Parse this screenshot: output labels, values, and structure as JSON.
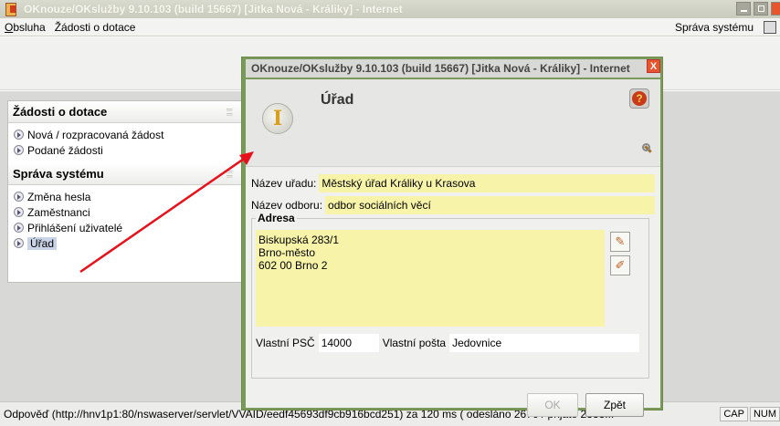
{
  "main_window": {
    "title": "OKnouze/OKslužby 9.10.103 (build 15667)  [Jitka Nová - Králiky] - Internet"
  },
  "menubar": {
    "items": [
      {
        "label": "Obsluha",
        "mnemonic": "O",
        "rest": "bsluha"
      },
      {
        "label": "Žádosti o dotace"
      }
    ],
    "right_label": "Správa systému"
  },
  "left_panel": {
    "sections": [
      {
        "title": "Žádosti o dotace",
        "items": [
          "Nová / rozpracovaná žádost",
          "Podané žádosti"
        ]
      },
      {
        "title": "Správa systému",
        "items": [
          "Změna hesla",
          "Zaměstnanci",
          "Přihlášení uživatelé",
          "Úřad"
        ]
      }
    ],
    "active_item": "Úřad"
  },
  "dialog": {
    "title": "OKnouze/OKslužby 9.10.103 (build 15667)  [Jitka Nová - Králiky] - Internet",
    "close_glyph": "X",
    "heading": "Úřad",
    "icon_glyph": "I",
    "help_glyph": "?",
    "fields": {
      "nazev_uradu_label": "Název uřadu:",
      "nazev_uradu_value": "Městský úřad Králiky u Krasova",
      "nazev_odboru_label": "Název odboru:",
      "nazev_odboru_value": "odbor sociálních věcí"
    },
    "address": {
      "legend": "Adresa",
      "lines": [
        "Biskupská 283/1",
        "Brno-město",
        "602 00 Brno 2"
      ],
      "psc_label": "Vlastní PSČ",
      "psc_value": "14000",
      "posta_label": "Vlastní pošta",
      "posta_value": "Jedovnice"
    },
    "buttons": {
      "ok": "OK",
      "back": "Zpět"
    }
  },
  "statusbar": {
    "message": "Odpověď (http://hnv1p1:80/nswaserver/servlet/VVAID/eedf45693df9cb916bcd251) za 120 ms ( odesláno 2676 / přijato 2333...",
    "indicators": [
      "CAP",
      "NUM"
    ]
  },
  "colors": {
    "dialog_frame": "#7a9a5a",
    "field_yellow": "#f7f3a8",
    "arrow": "#e8101a",
    "close_red": "#e8542c"
  }
}
